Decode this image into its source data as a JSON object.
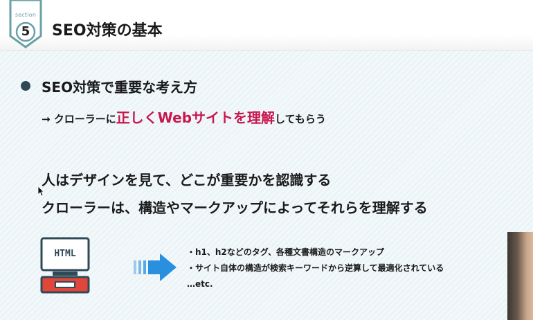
{
  "header": {
    "section_word": "section",
    "section_number": "5",
    "title": "SEO対策の基本"
  },
  "body": {
    "bullet_heading": "SEO対策で重要な考え方",
    "arrow_line": {
      "prefix": "→ クローラーに",
      "highlight": "正しくWebサイトを理解",
      "suffix": "してもらう"
    },
    "statement_1": "人はデザインを見て、どこが重要かを認識する",
    "statement_2": "クローラーは、構造やマークアップによってそれらを理解する",
    "html_icon_label": "HTML",
    "details": [
      "・h1、h2などのタグ、各種文書構造のマークアップ",
      "・サイト自体の構造が検索キーワードから逆算して最適化されている",
      "…etc."
    ]
  },
  "colors": {
    "badge_teal": "#6a9fa6",
    "highlight_red": "#c8174e",
    "arrow_blue": "#2b8fe0",
    "laptop_red": "#e0473a"
  },
  "icons": [
    "section-badge-icon",
    "html-laptop-icon",
    "right-arrow-icon",
    "mouse-cursor-icon"
  ]
}
